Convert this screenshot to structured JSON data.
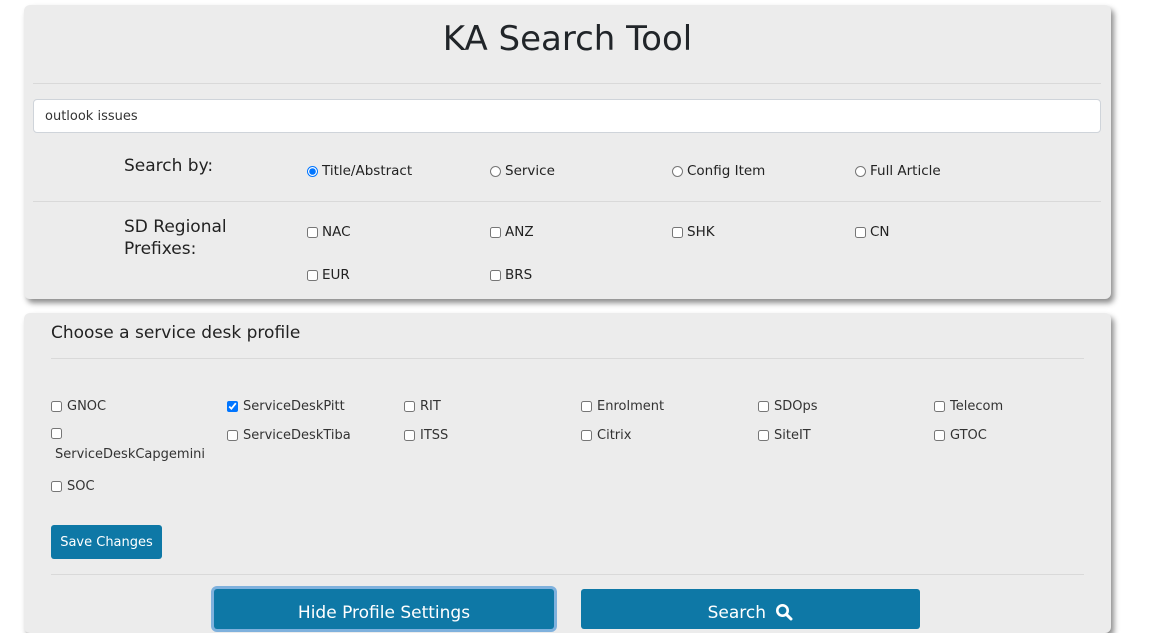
{
  "app": {
    "title": "KA Search Tool"
  },
  "search": {
    "query": "outlook issues"
  },
  "search_by": {
    "label": "Search by:",
    "options": [
      "Title/Abstract",
      "Service",
      "Config Item",
      "Full Article"
    ],
    "selected": "Title/Abstract"
  },
  "prefixes": {
    "label_line1": "SD Regional",
    "label_line2": "Prefixes:",
    "options": [
      "NAC",
      "ANZ",
      "SHK",
      "CN",
      "EUR",
      "BRS"
    ]
  },
  "profile": {
    "heading": "Choose a service desk profile",
    "items": [
      "GNOC",
      "ServiceDeskPitt",
      "RIT",
      "Enrolment",
      "SDOps",
      "Telecom",
      "ServiceDeskCapgemini",
      "ServiceDeskTiba",
      "ITSS",
      "Citrix",
      "SiteIT",
      "GTOC",
      "SOC"
    ],
    "checked": [
      "ServiceDeskPitt"
    ],
    "save_label": "Save Changes"
  },
  "actions": {
    "hide_label": "Hide Profile Settings",
    "search_label": "Search",
    "search_icon": "search-icon"
  },
  "colors": {
    "primary": "#0e78a6",
    "card_bg": "#ececec",
    "focus_ring": "#7fb1dd"
  }
}
